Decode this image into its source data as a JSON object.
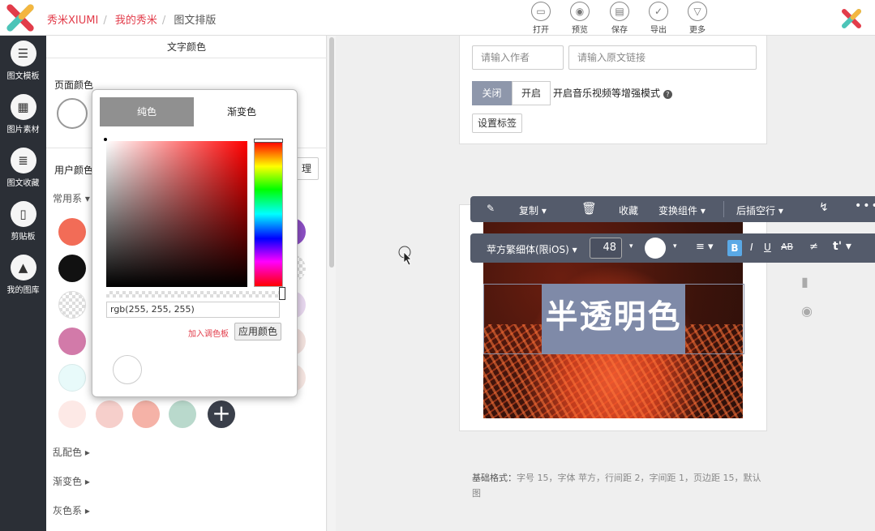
{
  "topbar": {
    "breadcrumb": [
      "秀米XIUMI",
      "我的秀米",
      "图文排版"
    ],
    "buttons": [
      {
        "label": "打开",
        "icon": "folder-icon"
      },
      {
        "label": "预览",
        "icon": "eye-icon"
      },
      {
        "label": "保存",
        "icon": "printer-icon"
      },
      {
        "label": "导出",
        "icon": "check-icon"
      },
      {
        "label": "更多",
        "icon": "chevron-down-icon"
      }
    ]
  },
  "nav": {
    "items": [
      {
        "label": "图文模板",
        "icon": "list-icon"
      },
      {
        "label": "图片素材",
        "icon": "image-icon"
      },
      {
        "label": "图文收藏",
        "icon": "bookmark-icon"
      },
      {
        "label": "剪贴板",
        "icon": "clipboard-icon"
      },
      {
        "label": "我的图库",
        "icon": "mountain-icon"
      }
    ]
  },
  "panel": {
    "title": "文字颜色",
    "page_color_label": "页面颜色",
    "user_color_label": "用户颜色",
    "manage_label": "理",
    "common_label": "常用系",
    "sections": [
      "乱配色",
      "渐变色",
      "灰色系"
    ]
  },
  "swatches": {
    "col1": [
      "#f26c57",
      "#111111",
      "checker",
      "#d27aa9",
      "#e8fafa",
      "#fde9e6"
    ],
    "bottom_row": [
      "#f6cfcb",
      "#f5b2a7",
      "#b9d9cc"
    ]
  },
  "picker": {
    "tab_solid": "纯色",
    "tab_gradient": "渐变色",
    "rgb_value": "rgb(255, 255, 255)",
    "add_palette": "加入调色板",
    "apply": "应用颜色"
  },
  "editor": {
    "author_placeholder": "请输入作者",
    "link_placeholder": "请输入原文链接",
    "off_label": "关闭",
    "on_label": "开启",
    "enhance_text": "开启音乐视频等增强模式",
    "tag_button": "设置标签",
    "headline": "半透明色",
    "base_format_title": "基础格式：",
    "base_format_text": "字号 15，字体 苹方，行间距 2，字间距 1，页边距 15，默认图"
  },
  "toolbar1": {
    "copy": "复制",
    "collect": "收藏",
    "transform": "变换组件",
    "insert_blank": "后插空行"
  },
  "toolbar2": {
    "font": "苹方繁细体(限iOS)",
    "size": "48",
    "bold": "B",
    "italic": "I",
    "underline": "U",
    "strike": "AB"
  }
}
